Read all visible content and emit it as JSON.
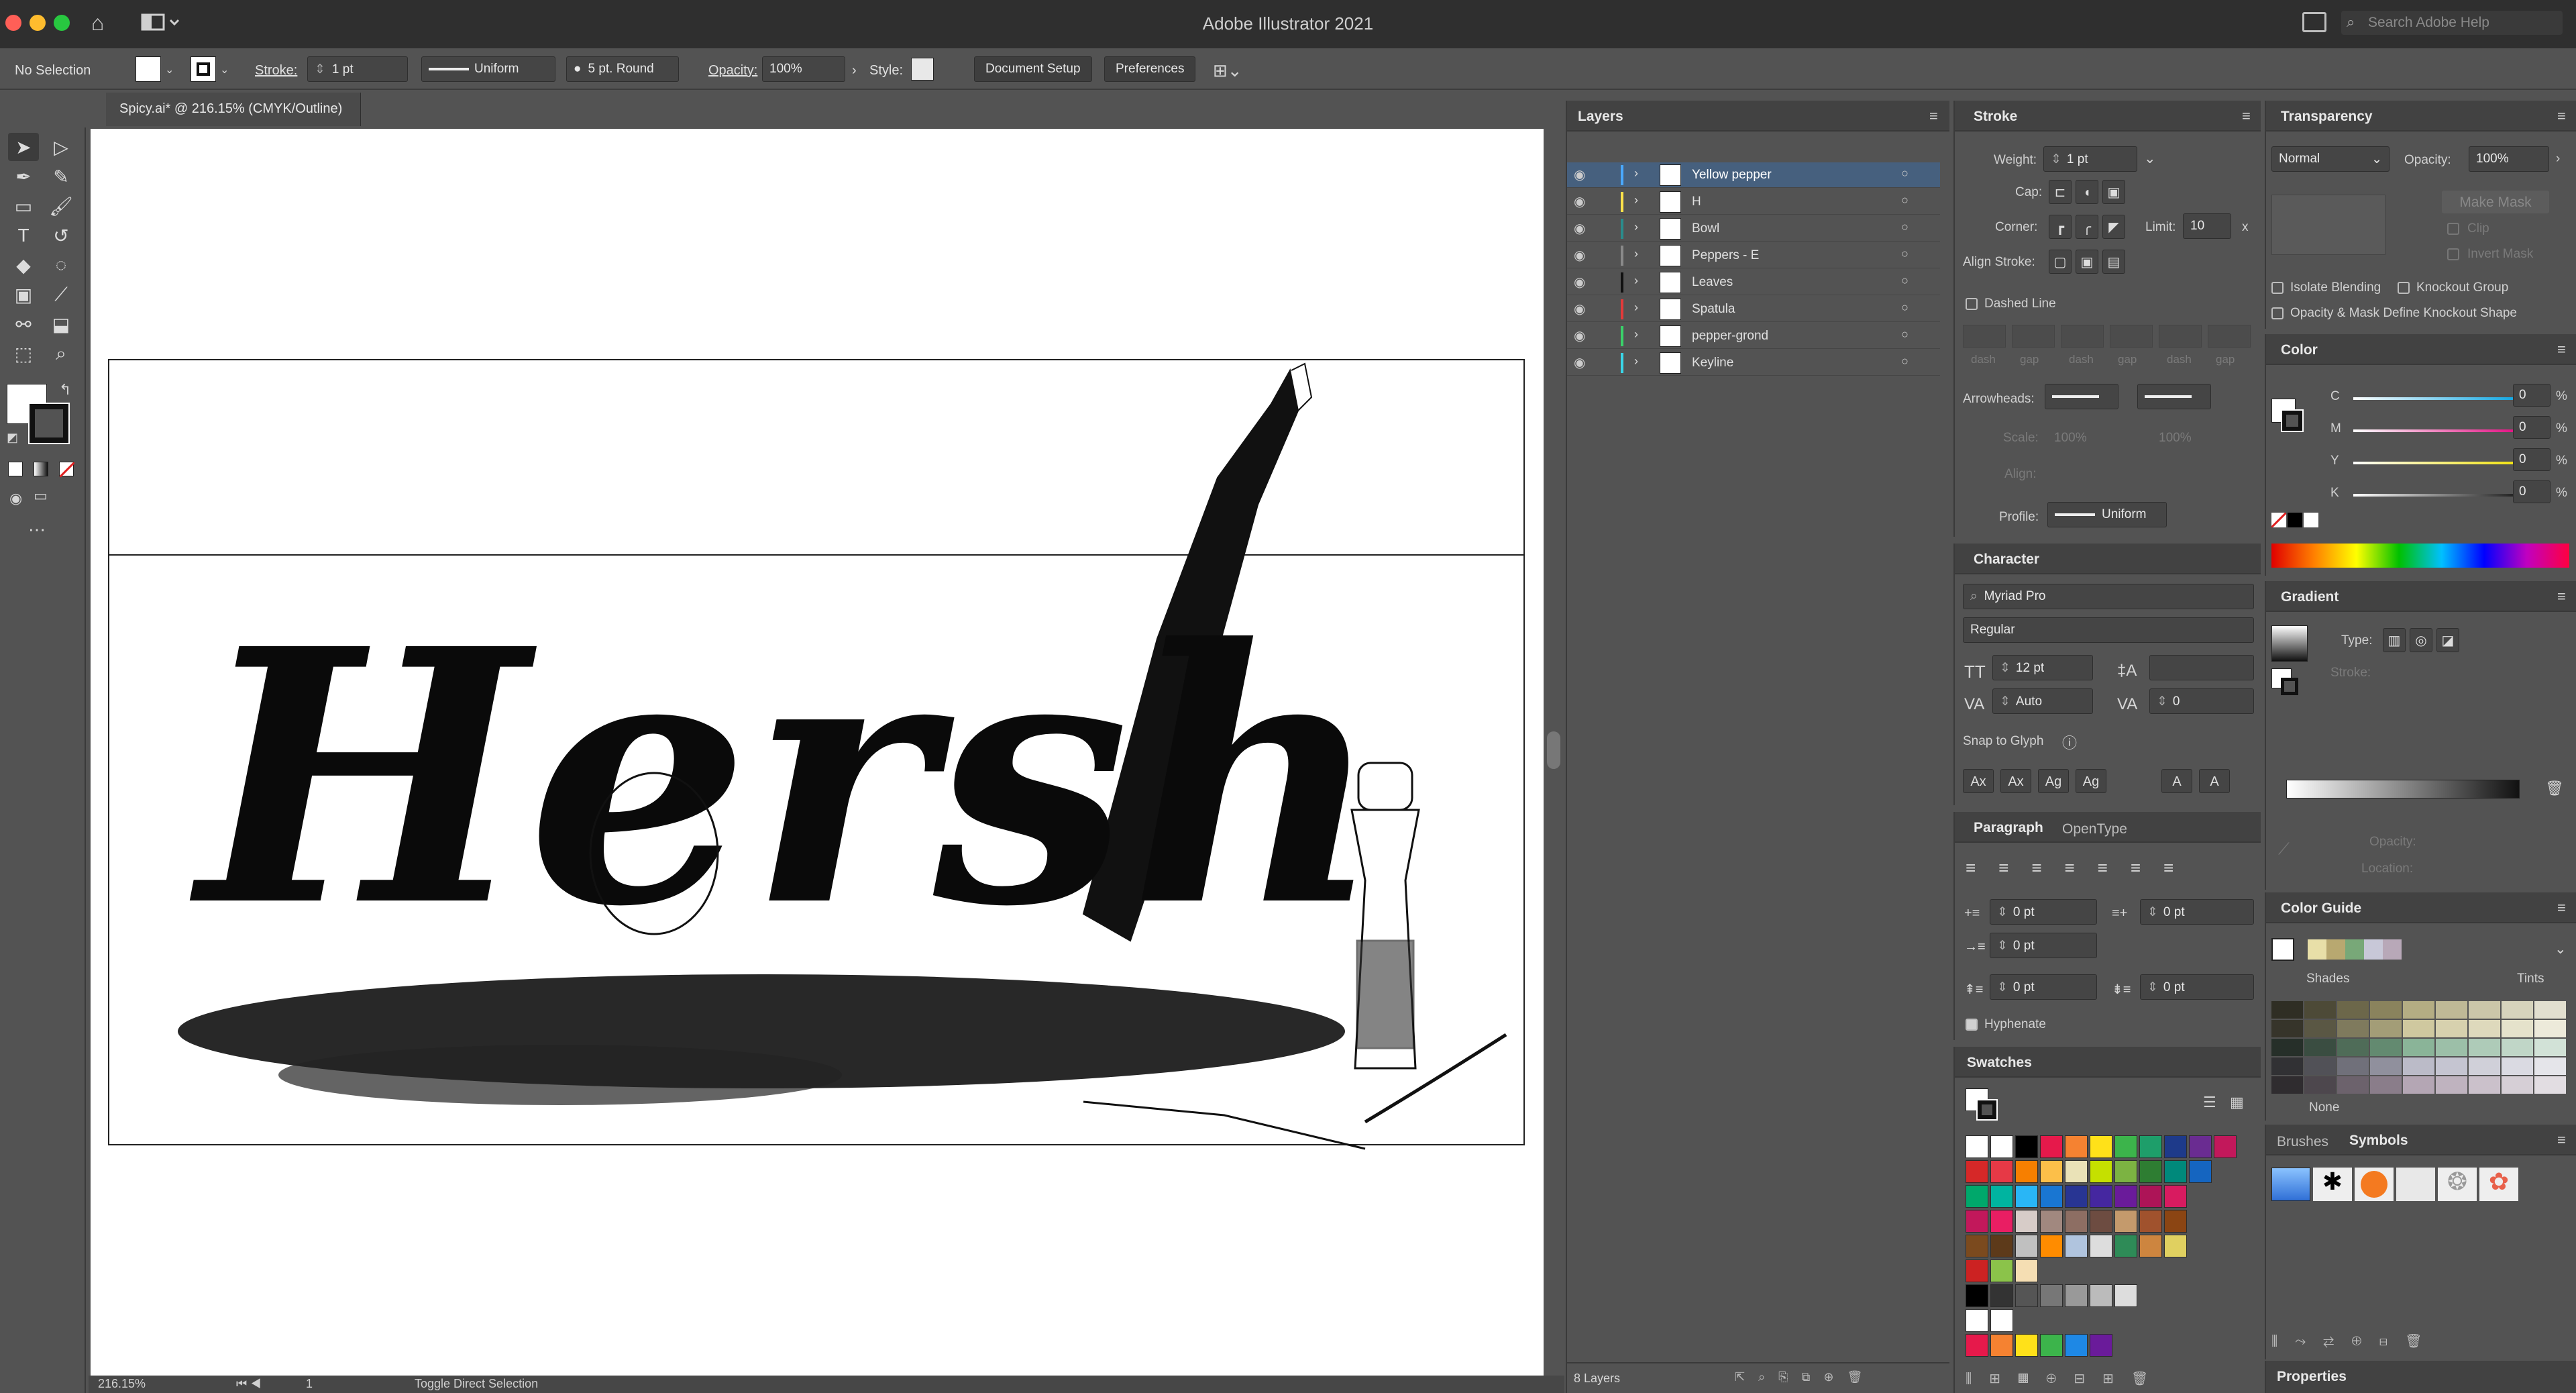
{
  "app": {
    "title": "Adobe Illustrator 2021",
    "search_placeholder": "Search Adobe Help"
  },
  "control_bar": {
    "selection": "No Selection",
    "stroke_label": "Stroke:",
    "stroke_weight": "1 pt",
    "profile": "Uniform",
    "brush": "5 pt. Round",
    "opacity_label": "Opacity:",
    "opacity": "100%",
    "style_label": "Style:",
    "document_setup": "Document Setup",
    "preferences": "Preferences"
  },
  "document_tab": {
    "title": "Spicy.ai* @ 216.15% (CMYK/Outline)"
  },
  "status_bar": {
    "zoom": "216.15%",
    "artboard": "1",
    "tool": "Toggle Direct Selection"
  },
  "artwork_text": "Hersh",
  "layers": {
    "title": "Layers",
    "items": [
      {
        "name": "Yellow pepper",
        "color": "#4aa8ff",
        "selected": true
      },
      {
        "name": "H",
        "color": "#ffe14a"
      },
      {
        "name": "Bowl",
        "color": "#2a8c8c"
      },
      {
        "name": "Peppers - E",
        "color": "#8a8a8a"
      },
      {
        "name": "Leaves",
        "color": "#111111"
      },
      {
        "name": "Spatula",
        "color": "#e23a3a"
      },
      {
        "name": "pepper-grond",
        "color": "#3ad16a"
      },
      {
        "name": "Keyline",
        "color": "#3ad6e8"
      }
    ],
    "count": "8 Layers"
  },
  "stroke_panel": {
    "title": "Stroke",
    "weight_label": "Weight:",
    "weight": "1 pt",
    "cap_label": "Cap:",
    "corner_label": "Corner:",
    "limit_label": "Limit:",
    "limit": "10",
    "limit_unit": "x",
    "align_label": "Align Stroke:",
    "dashed_line": "Dashed Line",
    "dash_labels": [
      "dash",
      "gap",
      "dash",
      "gap",
      "dash",
      "gap"
    ],
    "arrowheads_label": "Arrowheads:",
    "scale_label": "Scale:",
    "scale_values": [
      "100%",
      "100%"
    ],
    "align_label2": "Align:",
    "profile_label": "Profile:",
    "profile": "Uniform"
  },
  "character_panel": {
    "title": "Character",
    "font": "Myriad Pro",
    "style": "Regular",
    "size": "12 pt",
    "kerning": "Auto",
    "tracking": "0",
    "snap_to_glyph": "Snap to Glyph",
    "glyph_buttons": [
      "Ax",
      "Ax",
      "Ag",
      "Ag",
      "A",
      "A"
    ]
  },
  "paragraph_panel": {
    "tabs": [
      "Paragraph",
      "OpenType"
    ],
    "left_indent": "0 pt",
    "right_indent": "0 pt",
    "first_indent": "0 pt",
    "space_before": "0 pt",
    "space_after": "0 pt",
    "hyphenate": "Hyphenate"
  },
  "swatches": {
    "title": "Swatches",
    "rows": [
      [
        "#ffffff",
        "#ffffff",
        "#000000",
        "#e6194b",
        "#f58231",
        "#ffe119",
        "#3cb44b",
        "#1e9e6a",
        "#1e3a8a",
        "#6a2c91",
        "#c2185b"
      ],
      [
        "#d62828",
        "#e63946",
        "#f77f00",
        "#fcbf49",
        "#eae2b7",
        "#c5e000",
        "#7cb342",
        "#2e7d32",
        "#00897b",
        "#1565c0"
      ],
      [
        "#00a86b",
        "#00b4a0",
        "#29b6f6",
        "#1976d2",
        "#283593",
        "#4527a0",
        "#6a1b9a",
        "#ad1457",
        "#d81b60"
      ],
      [
        "#c2185b",
        "#e91e63",
        "#d7ccc8",
        "#a1887f",
        "#8d6e63",
        "#6d4c41",
        "#c49a6c",
        "#a0522d",
        "#8b4513"
      ],
      [
        "#7b4a1e",
        "#5d3a1a",
        "#c0c0c0",
        "#ff8c00",
        "#b0c4de",
        "#dddddd",
        "#2e8b57",
        "#cd853f",
        "#e0d060"
      ],
      [
        "#cc2222",
        "#8bc34a",
        "#f5deb3"
      ],
      [
        "#000000",
        "#333333",
        "#555555",
        "#777777",
        "#999999",
        "#bbbbbb",
        "#dddddd"
      ],
      [
        "#ffffff",
        "#ffffff"
      ],
      [
        "#e6194b",
        "#f58231",
        "#ffe119",
        "#3cb44b",
        "#1e88e5",
        "#6a1b9a"
      ]
    ]
  },
  "transparency": {
    "title": "Transparency",
    "mode": "Normal",
    "opacity_label": "Opacity:",
    "opacity": "100%",
    "make_mask": "Make Mask",
    "clip": "Clip",
    "invert_mask": "Invert Mask",
    "isolate": "Isolate Blending",
    "knockout": "Knockout Group",
    "opacity_mask": "Opacity & Mask Define Knockout Shape"
  },
  "color_panel": {
    "title": "Color",
    "channels": [
      {
        "label": "C",
        "value": "0",
        "color": "#00a0e0"
      },
      {
        "label": "M",
        "value": "0",
        "color": "#e0007a"
      },
      {
        "label": "Y",
        "value": "0",
        "color": "#f0e000"
      },
      {
        "label": "K",
        "value": "0",
        "color": "#111111"
      }
    ],
    "unit": "%"
  },
  "gradient_panel": {
    "title": "Gradient",
    "type_label": "Type:",
    "stroke_label": "Stroke:",
    "opacity_label": "Opacity:",
    "location_label": "Location:"
  },
  "color_guide": {
    "title": "Color Guide",
    "shades": "Shades",
    "tints": "Tints",
    "none": "None",
    "guide_colors": [
      "#e8dfa8",
      "#b8a870",
      "#78a878",
      "#c8c8d8",
      "#b8a8b8"
    ]
  },
  "brushes_tabs": [
    "Brushes",
    "Symbols"
  ],
  "properties": "Properties"
}
